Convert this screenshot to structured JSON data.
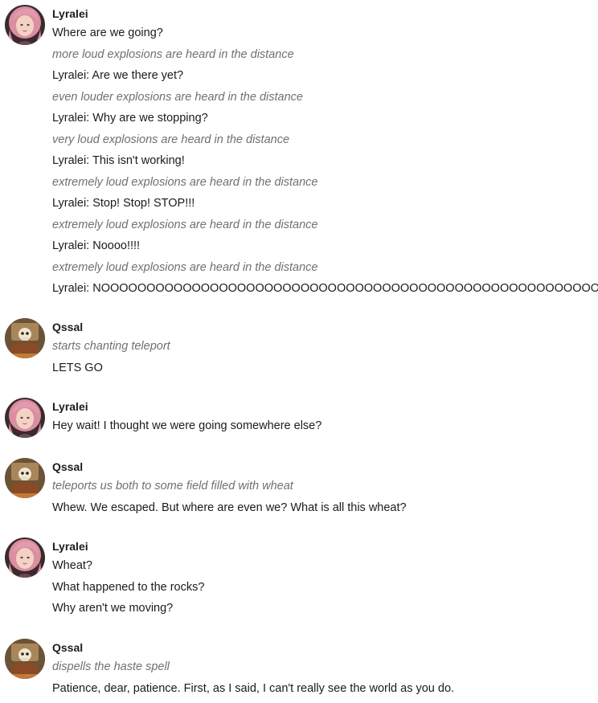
{
  "messages": [
    {
      "author": "Lyralei",
      "avatar": "lyralei-avatar",
      "lines": [
        {
          "text": "Where are we going?",
          "type": "speech"
        },
        {
          "text": "more loud explosions are heard in the distance",
          "type": "action"
        },
        {
          "text": "Lyralei: Are we there yet?",
          "type": "speech"
        },
        {
          "text": "even louder explosions are heard in the distance",
          "type": "action"
        },
        {
          "text": "Lyralei: Why are we stopping?",
          "type": "speech"
        },
        {
          "text": "very loud explosions are heard in the distance",
          "type": "action"
        },
        {
          "text": "Lyralei: This isn't working!",
          "type": "speech"
        },
        {
          "text": "extremely loud explosions are heard in the distance",
          "type": "action"
        },
        {
          "text": "Lyralei: Stop! Stop! STOP!!!",
          "type": "speech"
        },
        {
          "text": "extremely loud explosions are heard in the distance",
          "type": "action"
        },
        {
          "text": "Lyralei: Noooo!!!!",
          "type": "speech"
        },
        {
          "text": "extremely loud explosions are heard in the distance",
          "type": "action"
        },
        {
          "text": "Lyralei: NOOOOOOOOOOOOOOOOOOOOOOOOOOOOOOOOOOOOOOOOOOOOOOOOOOOOOOO",
          "type": "speech"
        }
      ]
    },
    {
      "author": "Qssal",
      "avatar": "qssal-avatar",
      "lines": [
        {
          "text": "starts chanting teleport",
          "type": "action"
        },
        {
          "text": "LETS GO",
          "type": "speech"
        }
      ]
    },
    {
      "author": "Lyralei",
      "avatar": "lyralei-avatar",
      "lines": [
        {
          "text": "Hey wait! I thought we were going somewhere else?",
          "type": "speech"
        }
      ]
    },
    {
      "author": "Qssal",
      "avatar": "qssal-avatar",
      "lines": [
        {
          "text": "teleports us both to some field filled with wheat",
          "type": "action"
        },
        {
          "text": "Whew. We escaped. But where are even we? What is all this wheat?",
          "type": "speech"
        }
      ]
    },
    {
      "author": "Lyralei",
      "avatar": "lyralei-avatar",
      "lines": [
        {
          "text": "Wheat?",
          "type": "speech"
        },
        {
          "text": "What happened to the rocks?",
          "type": "speech"
        },
        {
          "text": "Why aren't we moving?",
          "type": "speech"
        }
      ]
    },
    {
      "author": "Qssal",
      "avatar": "qssal-avatar",
      "lines": [
        {
          "text": "dispells the haste spell",
          "type": "action"
        },
        {
          "text": "Patience, dear, patience. First, as I said, I can't really see the world as you do.",
          "type": "speech"
        }
      ]
    }
  ]
}
